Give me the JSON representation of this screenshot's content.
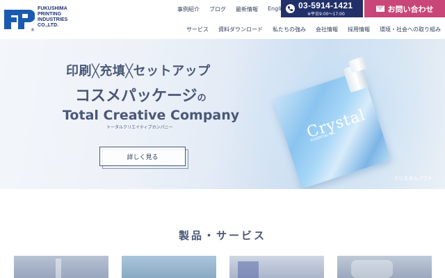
{
  "logo": {
    "text_lines": [
      "FUKUSHIMA",
      "PRINTING",
      "INDUSTRIES",
      "CO.,LTD."
    ],
    "mark": "FP",
    "registered": "®",
    "color": "#1a2f6f"
  },
  "top_nav": {
    "items": [
      {
        "label": "事例紹介"
      },
      {
        "label": "ブログ"
      },
      {
        "label": "最新情報"
      },
      {
        "label": "English"
      }
    ]
  },
  "phone": {
    "number": "03-5914-1421",
    "hours": "※平日9:00～17:00",
    "icon": "phone-icon",
    "bg_color": "#22306a"
  },
  "contact": {
    "label": "お問い合わせ",
    "icon": "mail-icon",
    "bg_color": "#c94778"
  },
  "main_nav": {
    "items": [
      {
        "label": "サービス"
      },
      {
        "label": "資料ダウンロード"
      },
      {
        "label": "私たちの強み"
      },
      {
        "label": "会社情報"
      },
      {
        "label": "採用情報"
      },
      {
        "label": "環境・社会への取り組み"
      }
    ]
  },
  "hero": {
    "line1": "印刷╳充填╳セットアップ",
    "line2_main": "コスメパッケージ",
    "line2_suffix": "の",
    "line3": "Total Creative Company",
    "kana": "トータルクリエイティブカンパニー",
    "button_label": "詳しく見る",
    "product_brand": "Crystal",
    "product_sub": "ESSENTIAL OIL",
    "caption": "クリスタルパウチ"
  },
  "products": {
    "title": "製品・サービス"
  }
}
